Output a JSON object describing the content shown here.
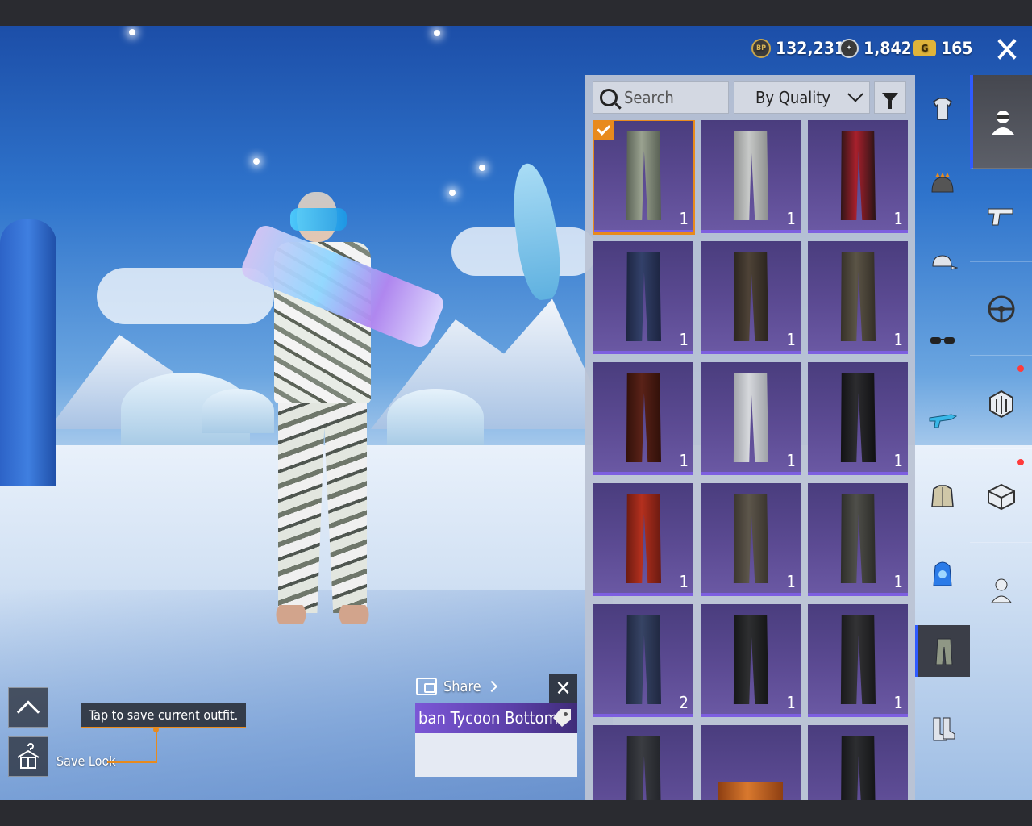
{
  "currency": {
    "bp": {
      "icon": "bp-coin-icon",
      "badge": "BP",
      "value": "132,231"
    },
    "ag": {
      "icon": "ag-coin-icon",
      "value": "1,842"
    },
    "uc": {
      "icon": "uc-coin-icon",
      "badge": "G",
      "value": "165"
    }
  },
  "close_icon": "✕",
  "inventory": {
    "search_placeholder": "Search",
    "sort_label": "By Quality",
    "items": [
      {
        "count": "1",
        "color": "#9aa290",
        "color2": "#565e52",
        "selected": true,
        "shape": "pants"
      },
      {
        "count": "1",
        "color": "#c7c9c8",
        "color2": "#8d8f8e",
        "shape": "pants"
      },
      {
        "count": "1",
        "color": "#a8202c",
        "color2": "#2a1416",
        "shape": "pants"
      },
      {
        "count": "1",
        "color": "#33416a",
        "color2": "#1c2440",
        "shape": "pants"
      },
      {
        "count": "1",
        "color": "#4e4337",
        "color2": "#2a241e",
        "shape": "pants"
      },
      {
        "count": "1",
        "color": "#5b5446",
        "color2": "#342f27",
        "shape": "pants"
      },
      {
        "count": "1",
        "color": "#5a2218",
        "color2": "#301009",
        "shape": "pants"
      },
      {
        "count": "1",
        "color": "#d6d8dc",
        "color2": "#9ea1a7",
        "shape": "pants"
      },
      {
        "count": "1",
        "color": "#2c2c2f",
        "color2": "#111113",
        "shape": "pants"
      },
      {
        "count": "1",
        "color": "#b4301e",
        "color2": "#6a1a10",
        "shape": "pants"
      },
      {
        "count": "1",
        "color": "#5d564b",
        "color2": "#39342d",
        "shape": "pants"
      },
      {
        "count": "1",
        "color": "#4f4f4a",
        "color2": "#2c2c28",
        "shape": "pants"
      },
      {
        "count": "2",
        "color": "#374465",
        "color2": "#1f2740",
        "shape": "pants"
      },
      {
        "count": "1",
        "color": "#2e2f31",
        "color2": "#141516",
        "shape": "pants"
      },
      {
        "count": "1",
        "color": "#333335",
        "color2": "#18181a",
        "shape": "pants"
      },
      {
        "count": "",
        "color": "#3b3d42",
        "color2": "#22242a",
        "shape": "pants"
      },
      {
        "count": "",
        "color": "#d9792e",
        "color2": "#8e3f12",
        "shape": "shorts"
      },
      {
        "count": "",
        "color": "#2d2e31",
        "color2": "#141517",
        "shape": "pants"
      }
    ]
  },
  "category_tabs": [
    {
      "name": "outfit-icon",
      "glyph": "shirt"
    },
    {
      "name": "helmet-icon",
      "glyph": "helmet"
    },
    {
      "name": "cap-icon",
      "glyph": "cap"
    },
    {
      "name": "glasses-icon",
      "glyph": "glasses"
    },
    {
      "name": "gun-skin-icon",
      "glyph": "gun"
    },
    {
      "name": "jacket-icon",
      "glyph": "jacket"
    },
    {
      "name": "backpack-icon",
      "glyph": "backpack"
    },
    {
      "name": "pants-icon",
      "glyph": "pants",
      "active": true
    },
    {
      "name": "shoes-icon",
      "glyph": "shoes"
    }
  ],
  "side_tabs": [
    {
      "name": "character-icon",
      "active": true
    },
    {
      "name": "pistol-icon"
    },
    {
      "name": "steering-wheel-icon"
    },
    {
      "name": "emblem-icon",
      "dot": true
    },
    {
      "name": "crate-icon",
      "dot": true
    },
    {
      "name": "companion-icon"
    }
  ],
  "save_look": {
    "tooltip": "Tap to save current outfit.",
    "label": "Save Look"
  },
  "item_card": {
    "share_label": "Share",
    "title": "ban Tycoon Bottom"
  }
}
